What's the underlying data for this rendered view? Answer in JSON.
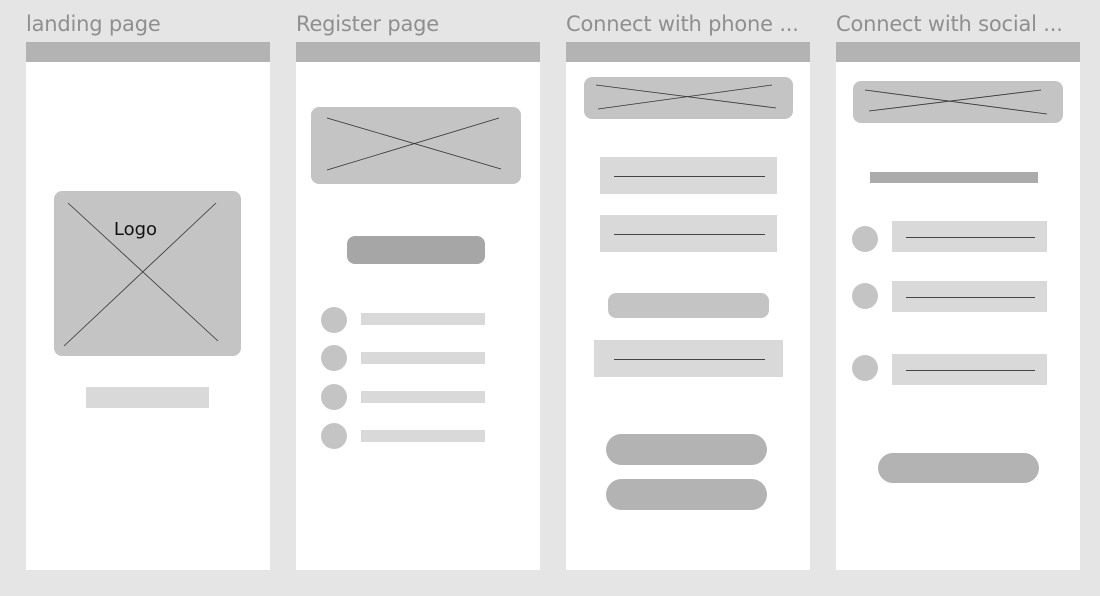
{
  "frames": {
    "landing": {
      "title": "landing page",
      "logo_label": "Logo"
    },
    "register": {
      "title": "Register page"
    },
    "phone": {
      "title": "Connect with phone ..."
    },
    "social": {
      "title": "Connect with social ..."
    }
  }
}
